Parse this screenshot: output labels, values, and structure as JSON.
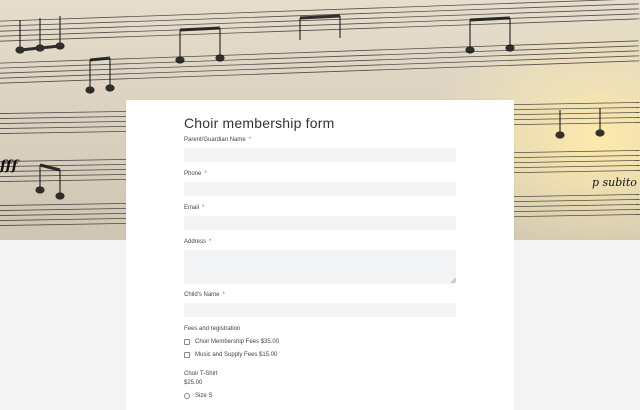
{
  "form": {
    "title": "Choir membership form",
    "required_marker": "*",
    "fields": {
      "parent_name": {
        "label": "Parent/Guardian Name",
        "value": ""
      },
      "phone": {
        "label": "Phone",
        "value": ""
      },
      "email": {
        "label": "Email",
        "value": ""
      },
      "address": {
        "label": "Address",
        "value": ""
      },
      "child_name": {
        "label": "Child's Name",
        "value": ""
      }
    },
    "fees": {
      "label": "Fees and registration",
      "options": [
        {
          "label": "Choir Membership Fees $35.00",
          "checked": false
        },
        {
          "label": "Music and Supply Fees $15.00",
          "checked": false
        }
      ]
    },
    "tshirt": {
      "label": "Choir T-Shirt",
      "price": "$25.00",
      "options": [
        {
          "label": "Size S",
          "selected": false
        }
      ]
    }
  },
  "banner": {
    "annotation": "p subito",
    "dynamic_marking": "fff"
  },
  "colors": {
    "required": "#d9534f",
    "input_background": "#f3f4f6",
    "page_background": "#f4f4f4"
  }
}
